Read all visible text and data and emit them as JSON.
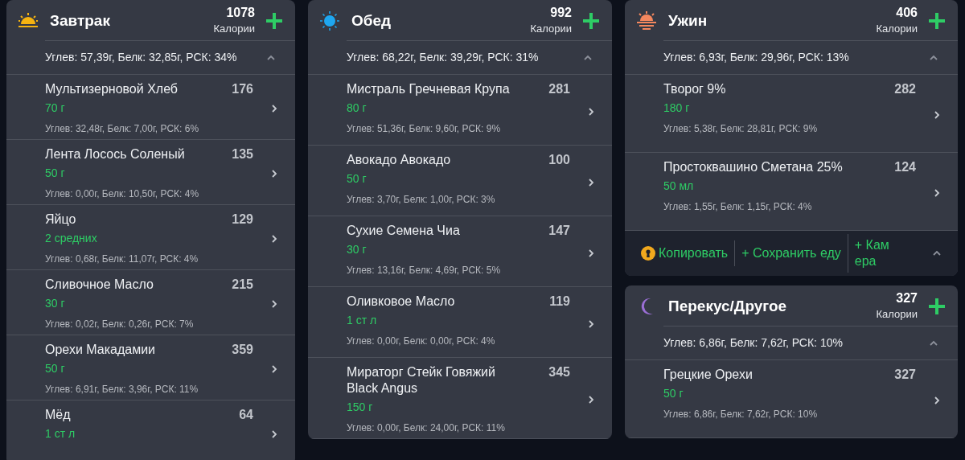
{
  "columns": [
    {
      "meals": [
        {
          "title": "Завтрак",
          "calories": "1078",
          "calories_label": "Калории",
          "summary": "Углев: 57,39г, Белк: 32,85г, РСК: 34%",
          "expanded": true,
          "items": [
            {
              "name": "Мультизерновой Хлеб",
              "amount": "70 г",
              "calories": "176",
              "summary": "Углев: 32,48г, Белк: 7,00г, РСК: 6%"
            },
            {
              "name": "Лента Лосось Соленый",
              "amount": "50 г",
              "calories": "135",
              "summary": "Углев: 0,00г, Белк: 10,50г, РСК: 4%"
            },
            {
              "name": "Яйцо",
              "amount": "2 средних",
              "calories": "129",
              "summary": "Углев: 0,68г, Белк: 11,07г, РСК: 4%"
            },
            {
              "name": "Сливочное Масло",
              "amount": "30 г",
              "calories": "215",
              "summary": "Углев: 0,02г, Белк: 0,26г, РСК: 7%"
            },
            {
              "name": "Орехи Макадамии",
              "amount": "50 г",
              "calories": "359",
              "summary": "Углев: 6,91г, Белк: 3,96г, РСК: 11%"
            },
            {
              "name": "Мёд",
              "amount": "1 ст л",
              "calories": "64"
            }
          ]
        }
      ]
    },
    {
      "meals": [
        {
          "title": "Обед",
          "calories": "992",
          "calories_label": "Калории",
          "summary": "Углев: 68,22г, Белк: 39,29г, РСК: 31%",
          "expanded": true,
          "items": [
            {
              "name": "Мистраль Гречневая Крупа",
              "amount": "80 г",
              "calories": "281",
              "summary": "Углев: 51,36г, Белк: 9,60г, РСК: 9%"
            },
            {
              "name": "Авокадо Авокадо",
              "amount": "50 г",
              "calories": "100",
              "summary": "Углев: 3,70г, Белк: 1,00г, РСК: 3%"
            },
            {
              "name": "Сухие Семена Чиа",
              "amount": "30 г",
              "calories": "147",
              "summary": "Углев: 13,16г, Белк: 4,69г, РСК: 5%"
            },
            {
              "name": "Оливковое Масло",
              "amount": "1 ст л",
              "calories": "119",
              "summary": "Углев: 0,00г, Белк: 0,00г, РСК: 4%"
            },
            {
              "name": "Мираторг Стейк Говяжий Black Angus",
              "amount": "150 г",
              "calories": "345",
              "summary": "Углев: 0,00г, Белк: 24,00г, РСК: 11%"
            }
          ]
        }
      ]
    },
    {
      "meals": [
        {
          "title": "Ужин",
          "calories": "406",
          "calories_label": "Калории",
          "summary": "Углев: 6,93г, Белк: 29,96г, РСК: 13%",
          "expanded": true,
          "items": [
            {
              "name": "Творог 9%",
              "amount": "180 г",
              "calories": "282",
              "summary": "Углев: 5,38г, Белк: 28,81г, РСК: 9%"
            },
            {
              "name": "Простоквашино Сметана 25%",
              "amount": "50 мл",
              "calories": "124",
              "summary": "Углев: 1,55г, Белк: 1,15г, РСК: 4%"
            }
          ],
          "footer": {
            "actions": [
              {
                "kind": "copy",
                "label": "Копировать"
              },
              {
                "kind": "save",
                "label": "+ Сохранить еду"
              },
              {
                "kind": "camera",
                "label": "+ Камера"
              }
            ]
          }
        },
        {
          "title": "Перекус/Другое",
          "calories": "327",
          "calories_label": "Калории",
          "summary": "Углев: 6,86г, Белк: 7,62г, РСК: 10%",
          "expanded": true,
          "items": [
            {
              "name": "Грецкие Орехи",
              "amount": "50 г",
              "calories": "327",
              "summary": "Углев: 6,86г, Белк: 7,62г, РСК: 10%"
            }
          ]
        }
      ]
    }
  ]
}
